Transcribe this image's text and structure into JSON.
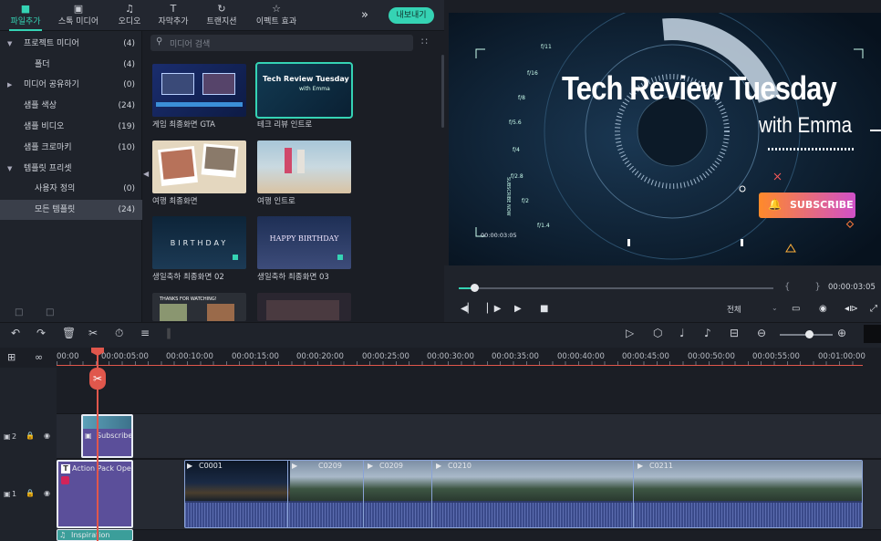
{
  "toolbar": {
    "tabs": [
      {
        "label": "파일추가",
        "icon": "folder-icon"
      },
      {
        "label": "스톡 미디어",
        "icon": "image-icon"
      },
      {
        "label": "오디오",
        "icon": "music-note-icon"
      },
      {
        "label": "자막추가",
        "icon": "text-icon"
      },
      {
        "label": "트랜지션",
        "icon": "transition-icon"
      },
      {
        "label": "이펙트 효과",
        "icon": "effects-icon"
      }
    ],
    "more": "»",
    "export_label": "내보내기"
  },
  "sidebar": {
    "items": [
      {
        "label": "프로젝트 미디어",
        "count": "(4)"
      },
      {
        "label": "폴더",
        "count": "(4)"
      },
      {
        "label": "미디어 공유하기",
        "count": "(0)"
      },
      {
        "label": "샘플 색상",
        "count": "(24)"
      },
      {
        "label": "샘플 비디오",
        "count": "(19)"
      },
      {
        "label": "샘플 크로마키",
        "count": "(10)"
      },
      {
        "label": "템플릿 프리셋",
        "count": ""
      },
      {
        "label": "사용자 정의",
        "count": "(0)"
      },
      {
        "label": "모든 템플릿",
        "count": "(24)"
      }
    ]
  },
  "media": {
    "search_placeholder": "미디어 검색",
    "items": [
      {
        "label": "게임 최종화면 GTA"
      },
      {
        "label": "테크 리뷰 인트로",
        "thumb_title": "Tech Review Tuesday",
        "thumb_sub": "with Emma"
      },
      {
        "label": "여행 최종화면"
      },
      {
        "label": "여행 인트로"
      },
      {
        "label": "생일축하 최종화면 02",
        "thumb_title": "BIRTHDAY"
      },
      {
        "label": "생일축하 최종화면 03",
        "thumb_title": "HAPPY BIRTHDAY"
      },
      {
        "label": "",
        "thumb_title": "THANKS FOR WATCHING!"
      },
      {
        "label": ""
      }
    ]
  },
  "preview": {
    "title": "Tech Review Tuesday",
    "subtitle": "with Emma",
    "subscribe": "SUBSCRIBE",
    "hud_time": "00:00:03:05",
    "hud_ticks": [
      "f/8",
      "f/5.6",
      "f/4",
      "f/2.8",
      "f/2",
      "f/1.4",
      "f/16",
      "f/11"
    ],
    "hud_vertical": "SUBSCRIBE NOW",
    "brand_color": "#35d3b4"
  },
  "player": {
    "progress": 0.05,
    "braces": "{ }",
    "timecode": "00:00:03:05",
    "quality": "전체"
  },
  "ruler": {
    "labels": [
      "00:00",
      "00:00:05:00",
      "00:00:10:00",
      "00:00:15:00",
      "00:00:20:00",
      "00:00:25:00",
      "00:00:30:00",
      "00:00:35:00",
      "00:00:40:00",
      "00:00:45:00",
      "00:00:50:00",
      "00:00:55:00",
      "00:01:00:00"
    ]
  },
  "tracks": {
    "track2": {
      "num": "2",
      "clip": "Subscribe"
    },
    "track1": {
      "num": "1",
      "title_clip": "Action Pack Opener",
      "clips": [
        "C0001",
        "C0209",
        "C0209",
        "C0210",
        "C0211"
      ],
      "audio_clip": "Inspiration"
    }
  },
  "colors": {
    "accent": "#35d3b4",
    "playhead": "#e0574c",
    "clip_purple": "#5b4f9a"
  }
}
